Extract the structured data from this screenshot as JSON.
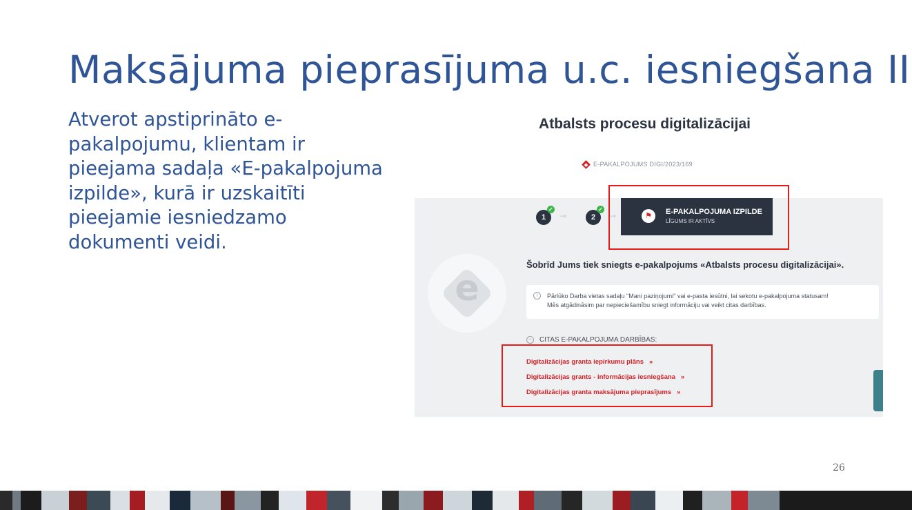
{
  "slide": {
    "title": "Maksājuma pieprasījuma u.c. iesniegšana II",
    "body_lines": [
      "Atverot apstiprināto e-",
      "pakalpojumu, klientam ir",
      "pieejama sadaļa «E-pakalpojuma",
      "izpilde», kurā ir uzskaitīti",
      "pieejamie iesniedzamo",
      "dokumenti veidi."
    ],
    "page_number": "26"
  },
  "screenshot": {
    "heading": "Atbalsts procesu digitalizācijai",
    "service_id": "E-PAKALPOJUMS DIGI/2023/169",
    "steps": [
      {
        "label": "1",
        "completed": true
      },
      {
        "label": "2",
        "completed": true
      }
    ],
    "current_step": {
      "title": "E-PAKALPOJUMA IZPILDE",
      "subtitle": "LĪGUMS IR AKTĪVS"
    },
    "status_text": "Šobrīd Jums tiek sniegts e-pakalpojums «Atbalsts procesu digitalizācijai».",
    "info_lines": [
      "Pārlūko Darba vietas sadaļu \"Mani paziņojumi\" vai e-pasta iesūtni, lai sekotu e-pakalpojuma statusam!",
      "Mēs atgādināsim par nepieciešamību sniegt informāciju vai veikt citas darbības."
    ],
    "logo_letter": "e",
    "other_actions_label": "CITAS E-PAKALPOJUMA DARBĪBAS:",
    "actions": [
      "Digitalizācijas granta iepirkumu plāns",
      "Digitalizācijas grants - informācijas iesniegšana",
      "Digitalizācijas granta maksājuma pieprasījums"
    ],
    "chevron": "»"
  },
  "colors": {
    "title_blue": "#2f5597",
    "dark_navy": "#2c3340",
    "accent_red": "#d62027",
    "highlight_red": "#e81b1b",
    "check_green": "#3cb54a"
  },
  "icons": [
    "check-icon",
    "flag-icon",
    "info-icon",
    "minus-circle-icon",
    "e-pakalpojums-logo",
    "diamond-logo-icon"
  ]
}
